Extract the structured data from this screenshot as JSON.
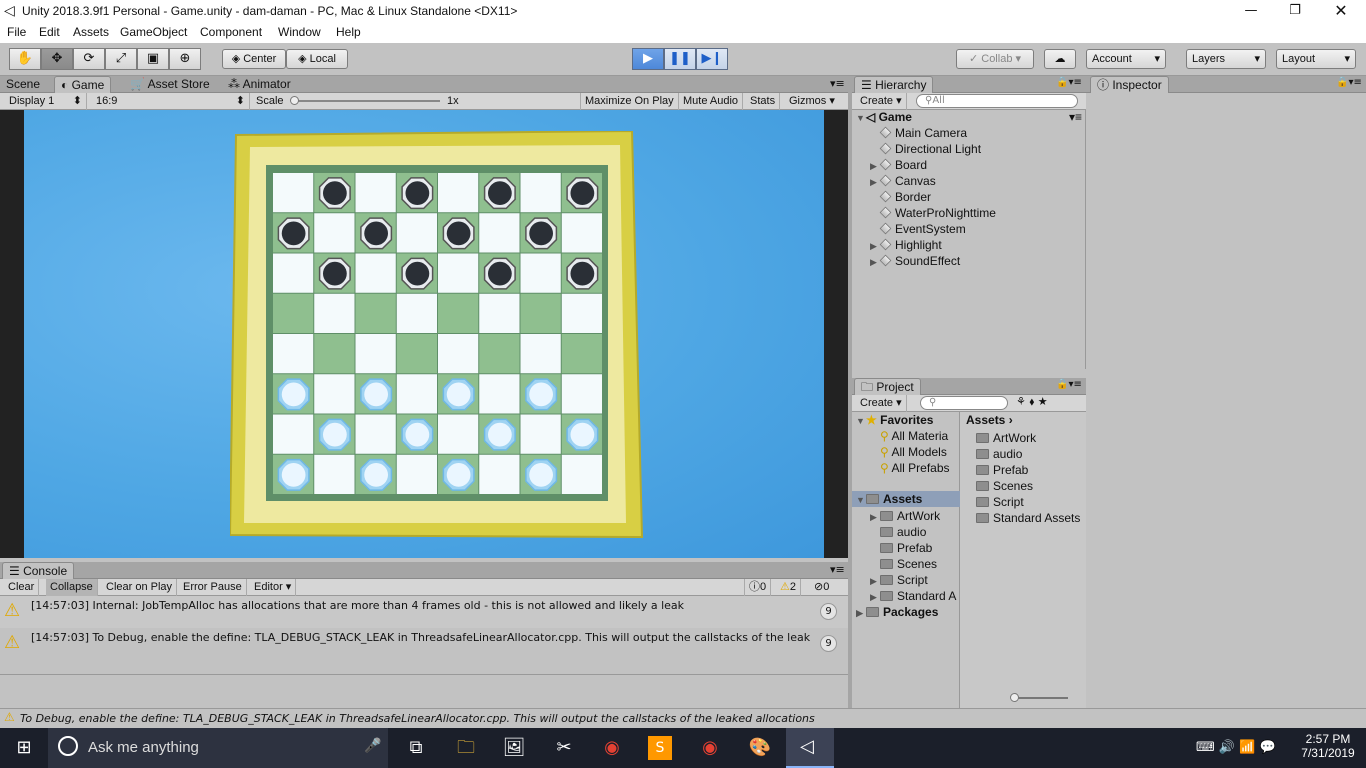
{
  "window": {
    "title": "Unity 2018.3.9f1 Personal - Game.unity - dam-daman - PC, Mac & Linux Standalone <DX11>"
  },
  "menu": [
    "File",
    "Edit",
    "Assets",
    "GameObject",
    "Component",
    "Window",
    "Help"
  ],
  "toolbar": {
    "center": "Center",
    "local": "Local",
    "collab": "Collab",
    "account": "Account",
    "layers": "Layers",
    "layout": "Layout"
  },
  "game_tabs": [
    "Scene",
    "Game",
    "Asset Store",
    "Animator"
  ],
  "game_controls": {
    "display": "Display 1",
    "aspect": "16:9",
    "scale_label": "Scale",
    "scale_value": "1x",
    "maximize": "Maximize On Play",
    "mute": "Mute Audio",
    "stats": "Stats",
    "gizmos": "Gizmos"
  },
  "hierarchy": {
    "tab": "Hierarchy",
    "create": "Create",
    "search_placeholder": "All",
    "scene": "Game",
    "items": [
      {
        "label": "Main Camera",
        "expandable": false
      },
      {
        "label": "Directional Light",
        "expandable": false
      },
      {
        "label": "Board",
        "expandable": true
      },
      {
        "label": "Canvas",
        "expandable": true
      },
      {
        "label": "Border",
        "expandable": false
      },
      {
        "label": "WaterProNighttime",
        "expandable": false
      },
      {
        "label": "EventSystem",
        "expandable": false
      },
      {
        "label": "Highlight",
        "expandable": true
      },
      {
        "label": "SoundEffect",
        "expandable": true
      }
    ]
  },
  "inspector": {
    "tab": "Inspector"
  },
  "project": {
    "tab": "Project",
    "create": "Create",
    "favorites_label": "Favorites",
    "favorites": [
      "All Materia",
      "All Models",
      "All Prefabs"
    ],
    "assets_label": "Assets",
    "tree": [
      {
        "label": "ArtWork",
        "expandable": true
      },
      {
        "label": "audio",
        "expandable": false
      },
      {
        "label": "Prefab",
        "expandable": false
      },
      {
        "label": "Scenes",
        "expandable": false
      },
      {
        "label": "Script",
        "expandable": true
      },
      {
        "label": "Standard A",
        "expandable": true
      }
    ],
    "packages_label": "Packages",
    "breadcrumb": "Assets",
    "grid": [
      "ArtWork",
      "audio",
      "Prefab",
      "Scenes",
      "Script",
      "Standard Assets"
    ]
  },
  "console": {
    "tab": "Console",
    "buttons": [
      "Clear",
      "Collapse",
      "Clear on Play",
      "Error Pause",
      "Editor"
    ],
    "counts": {
      "info": "0",
      "warn": "2",
      "error": "0"
    },
    "messages": [
      {
        "text": "[14:57:03] Internal: JobTempAlloc has allocations that are more than 4 frames old - this is not allowed and likely a leak",
        "count": "9"
      },
      {
        "text": "[14:57:03] To Debug, enable the define: TLA_DEBUG_STACK_LEAK in ThreadsafeLinearAllocator.cpp. This will output the callstacks of the leak",
        "count": "9"
      }
    ]
  },
  "status_bar": "To Debug, enable the define: TLA_DEBUG_STACK_LEAK in ThreadsafeLinearAllocator.cpp. This will output the callstacks of the leaked allocations",
  "taskbar": {
    "search_placeholder": "Ask me anything",
    "time": "2:57 PM",
    "date": "7/31/2019"
  },
  "board": {
    "rows": 8,
    "cols": 8,
    "dark_pieces": [
      [
        0,
        1
      ],
      [
        0,
        3
      ],
      [
        0,
        5
      ],
      [
        0,
        7
      ],
      [
        1,
        0
      ],
      [
        1,
        2
      ],
      [
        1,
        4
      ],
      [
        1,
        6
      ],
      [
        2,
        1
      ],
      [
        2,
        3
      ],
      [
        2,
        5
      ],
      [
        2,
        7
      ]
    ],
    "light_pieces": [
      [
        5,
        0
      ],
      [
        5,
        2
      ],
      [
        5,
        4
      ],
      [
        5,
        6
      ],
      [
        6,
        1
      ],
      [
        6,
        3
      ],
      [
        6,
        5
      ],
      [
        6,
        7
      ],
      [
        7,
        0
      ],
      [
        7,
        2
      ],
      [
        7,
        4
      ],
      [
        7,
        6
      ]
    ],
    "colors": {
      "water": "#4fa7e4",
      "frame": "#d9cf45",
      "light_square": "#f4fafc",
      "dark_square": "#8fbf8f",
      "dark_piece": "#2a2f36",
      "light_piece": "#eaf6ff"
    }
  }
}
